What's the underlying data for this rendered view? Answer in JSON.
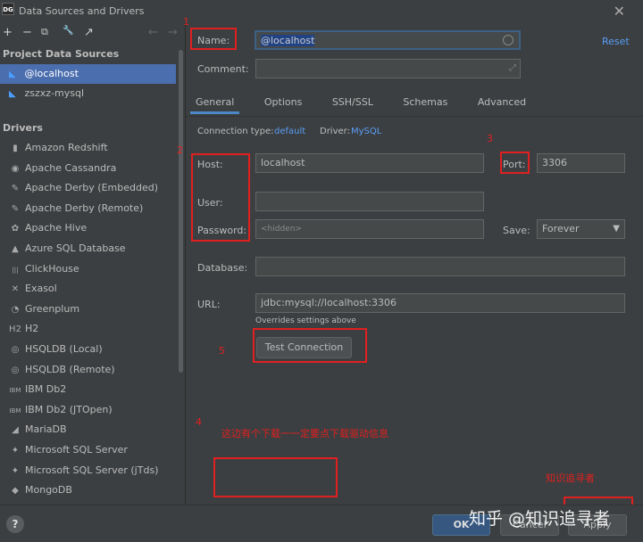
{
  "window": {
    "title": "Data Sources and Drivers",
    "app_icon": "DG",
    "close": "✕"
  },
  "toolbar": {
    "add": "+",
    "remove": "−",
    "copy": "⧉",
    "settings": "🔧",
    "edit": "↗",
    "back": "←",
    "forward": "→"
  },
  "sidebar": {
    "project_title": "Project Data Sources",
    "data_sources": [
      {
        "label": "@localhost",
        "selected": true
      },
      {
        "label": "zszxz-mysql",
        "selected": false
      }
    ],
    "drivers_title": "Drivers",
    "drivers": [
      {
        "label": "Amazon Redshift",
        "icon": "redshift-icon",
        "glyph": "▮"
      },
      {
        "label": "Apache Cassandra",
        "icon": "cassandra-icon",
        "glyph": "◉"
      },
      {
        "label": "Apache Derby (Embedded)",
        "icon": "derby-icon",
        "glyph": "✎"
      },
      {
        "label": "Apache Derby (Remote)",
        "icon": "derby-icon",
        "glyph": "✎"
      },
      {
        "label": "Apache Hive",
        "icon": "hive-icon",
        "glyph": "✿"
      },
      {
        "label": "Azure SQL Database",
        "icon": "azure-icon",
        "glyph": "▲"
      },
      {
        "label": "ClickHouse",
        "icon": "clickhouse-icon",
        "glyph": "|||"
      },
      {
        "label": "Exasol",
        "icon": "exasol-icon",
        "glyph": "✕"
      },
      {
        "label": "Greenplum",
        "icon": "greenplum-icon",
        "glyph": "◔"
      },
      {
        "label": "H2",
        "icon": "h2-icon",
        "glyph": "H2"
      },
      {
        "label": "HSQLDB (Local)",
        "icon": "hsqldb-icon",
        "glyph": "◎"
      },
      {
        "label": "HSQLDB (Remote)",
        "icon": "hsqldb-icon",
        "glyph": "◎"
      },
      {
        "label": "IBM Db2",
        "icon": "ibm-icon",
        "glyph": "IBM"
      },
      {
        "label": "IBM Db2 (JTOpen)",
        "icon": "ibm-icon",
        "glyph": "IBM"
      },
      {
        "label": "MariaDB",
        "icon": "mariadb-icon",
        "glyph": "◢"
      },
      {
        "label": "Microsoft SQL Server",
        "icon": "mssql-icon",
        "glyph": "✦"
      },
      {
        "label": "Microsoft SQL Server (jTds)",
        "icon": "mssql-icon",
        "glyph": "✦"
      },
      {
        "label": "MongoDB",
        "icon": "mongodb-icon",
        "glyph": "◆"
      }
    ]
  },
  "form": {
    "name_label": "Name:",
    "name_value": "@localhost",
    "reset": "Reset",
    "comment_label": "Comment:",
    "tabs": [
      "General",
      "Options",
      "SSH/SSL",
      "Schemas",
      "Advanced"
    ],
    "connection_type_label": "Connection type:",
    "connection_type_value": "default",
    "driver_label": "Driver:",
    "driver_value": "MySQL",
    "host_label": "Host:",
    "host_value": "localhost",
    "port_label": "Port:",
    "port_value": "3306",
    "user_label": "User:",
    "password_label": "Password:",
    "password_value": "<hidden>",
    "save_label": "Save:",
    "save_value": "Forever",
    "database_label": "Database:",
    "url_label": "URL:",
    "url_value": "jdbc:mysql://localhost:3306",
    "url_note": "Overrides settings above",
    "test_connection": "Test Connection"
  },
  "annotations": {
    "n1": "1",
    "n2": "2",
    "n3": "3",
    "n4": "4",
    "n5": "5",
    "note": "这边有个下载一一定要点下载驱动信息",
    "author": "知识追寻者",
    "color": "#e02020"
  },
  "footer": {
    "help": "?",
    "ok": "OK",
    "cancel": "Cancel",
    "apply": "Apply",
    "watermark": "知乎 @知识追寻者"
  }
}
